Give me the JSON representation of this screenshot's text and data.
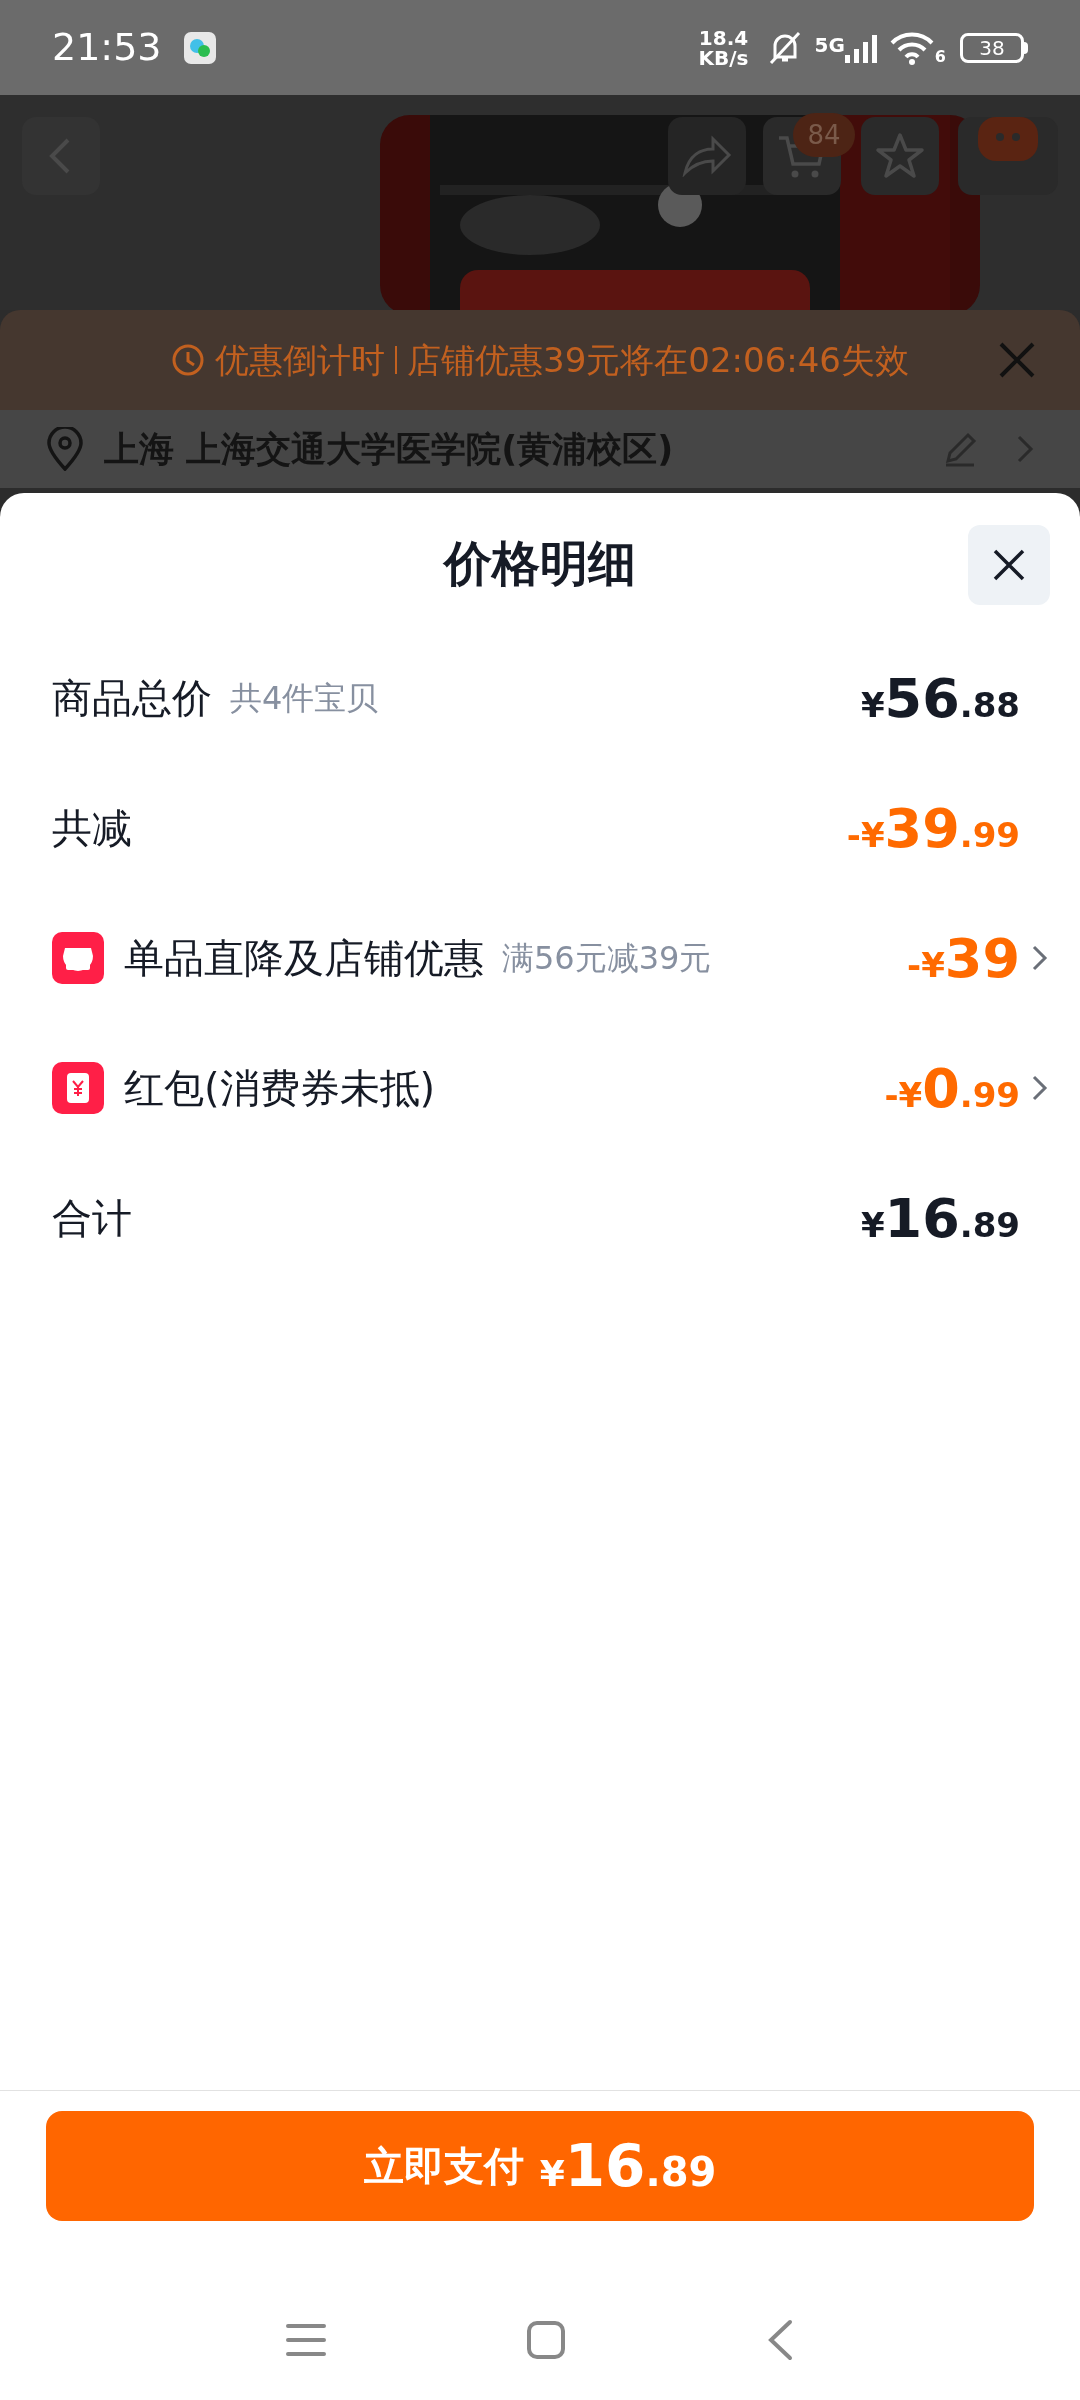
{
  "status_bar": {
    "time": "21:53",
    "net_speed": [
      "18.4",
      "KB/s"
    ],
    "network": "5G",
    "wifi_label": "6",
    "battery": "38"
  },
  "product_header": {
    "cart_badge": "84"
  },
  "promo_banner": {
    "label": "优惠倒计时",
    "message": "店铺优惠39元将在02:06:46失效"
  },
  "address": {
    "text": "上海 上海交通大学医学院(黄浦校区)"
  },
  "sheet": {
    "title": "价格明细",
    "rows": [
      {
        "kind": "plain",
        "label": "商品总价",
        "note": "共4件宝贝",
        "amount": "¥56.88",
        "highlight": false,
        "link": false
      },
      {
        "kind": "plain",
        "label": "共减",
        "amount": "-¥39.99",
        "highlight": true,
        "link": false
      },
      {
        "kind": "shop",
        "label": "单品直降及店铺优惠",
        "note": "满56元减39元",
        "amount": "-¥39",
        "highlight": true,
        "link": true
      },
      {
        "kind": "redpacket",
        "label": "红包(消费券未抵)",
        "amount": "-¥0.99",
        "highlight": true,
        "link": true
      },
      {
        "kind": "plain",
        "label": "合计",
        "amount": "¥16.89",
        "highlight": false,
        "link": false
      }
    ]
  },
  "pay_button": {
    "label": "立即支付",
    "amount": "¥16.89"
  }
}
